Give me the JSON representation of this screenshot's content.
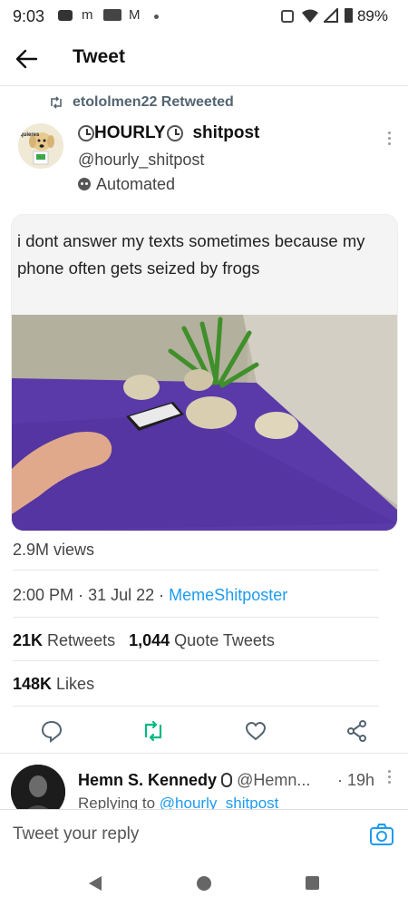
{
  "status_bar": {
    "time": "9:03",
    "battery": "89%"
  },
  "header": {
    "title": "Tweet"
  },
  "retweet": {
    "text": "etololmen22 Retweeted"
  },
  "author": {
    "name_part1": "HOURLY",
    "name_part2": "shitpost",
    "handle": "@hourly_shitpost",
    "automated": "Automated",
    "avatar_text": "quieres"
  },
  "tweet": {
    "meme_text": "i dont answer my texts sometimes because my phone often gets seized by frogs"
  },
  "stats": {
    "views": "2.9M views",
    "time": "2:00 PM",
    "date": "31 Jul 22",
    "source": "MemeShitposter",
    "retweets_count": "21K",
    "retweets_label": "Retweets",
    "quotes_count": "1,044",
    "quotes_label": "Quote Tweets",
    "likes_count": "148K",
    "likes_label": "Likes"
  },
  "reply": {
    "name": "Hemn S. Kennedy",
    "handle": "@Hemn...",
    "time": "· 19h",
    "replying_prefix": "Replying to",
    "replying_to": "@hourly_shitpost"
  },
  "composer": {
    "placeholder": "Tweet your reply"
  },
  "colors": {
    "accent": "#1d9bf0",
    "retweet_green": "#00ba7c",
    "rug_purple": "#5a3aa8"
  },
  "icons": [
    "back-arrow-icon",
    "retweet-icon",
    "clock-icon",
    "bot-icon",
    "more-icon",
    "reply-icon",
    "like-icon",
    "share-icon",
    "camera-icon",
    "nav-back-icon",
    "nav-home-icon",
    "nav-recents-icon"
  ]
}
